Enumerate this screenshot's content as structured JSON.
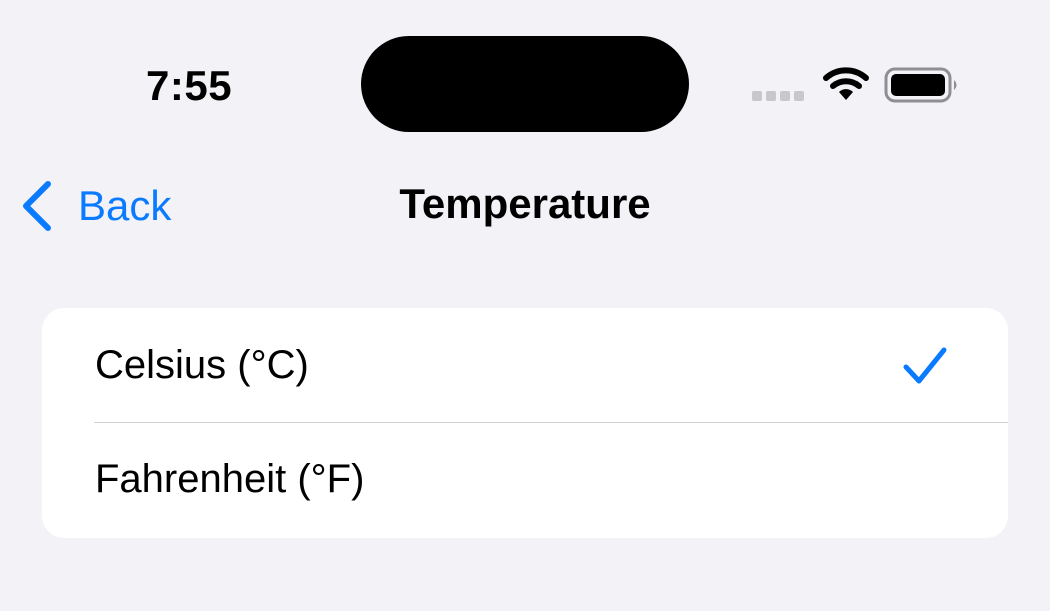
{
  "status_bar": {
    "time": "7:55",
    "icons": [
      "signal-dots-icon",
      "wifi-icon",
      "battery-icon"
    ]
  },
  "nav": {
    "back_label": "Back",
    "title": "Temperature"
  },
  "options": [
    {
      "label": "Celsius (°C)",
      "selected": true
    },
    {
      "label": "Fahrenheit (°F)",
      "selected": false
    }
  ],
  "colors": {
    "accent": "#0A7AFF",
    "background": "#F2F2F7",
    "card": "#FFFFFF",
    "divider": "#D1D1D6"
  }
}
